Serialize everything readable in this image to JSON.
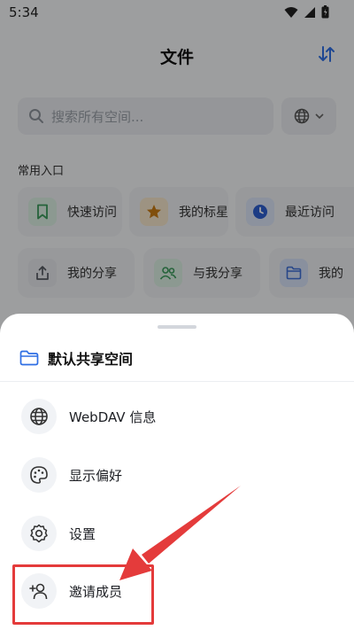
{
  "status_bar": {
    "time": "5:34"
  },
  "header": {
    "title": "文件"
  },
  "search": {
    "placeholder": "搜索所有空间..."
  },
  "section": {
    "label": "常用入口"
  },
  "shortcuts": [
    {
      "label": "快速访问",
      "icon": "bookmark-icon",
      "color": "#3a9b5c"
    },
    {
      "label": "我的标星",
      "icon": "star-icon",
      "color": "#c97b12"
    },
    {
      "label": "最近访问",
      "icon": "clock-icon",
      "color": "#2d5fd0"
    },
    {
      "label": "我的分享",
      "icon": "share-icon",
      "color": "#555a62"
    },
    {
      "label": "与我分享",
      "icon": "users-icon",
      "color": "#3a9b5c"
    },
    {
      "label": "我的",
      "icon": "folder-icon",
      "color": "#3d6fd6"
    }
  ],
  "sheet": {
    "title": "默认共享空间",
    "items": [
      {
        "label": "WebDAV 信息",
        "icon": "globe-icon"
      },
      {
        "label": "显示偏好",
        "icon": "palette-icon"
      },
      {
        "label": "设置",
        "icon": "gear-icon"
      },
      {
        "label": "邀请成员",
        "icon": "add-user-icon"
      }
    ]
  },
  "colors": {
    "accent": "#2f6fe4",
    "annotation": "#e43b3b"
  }
}
